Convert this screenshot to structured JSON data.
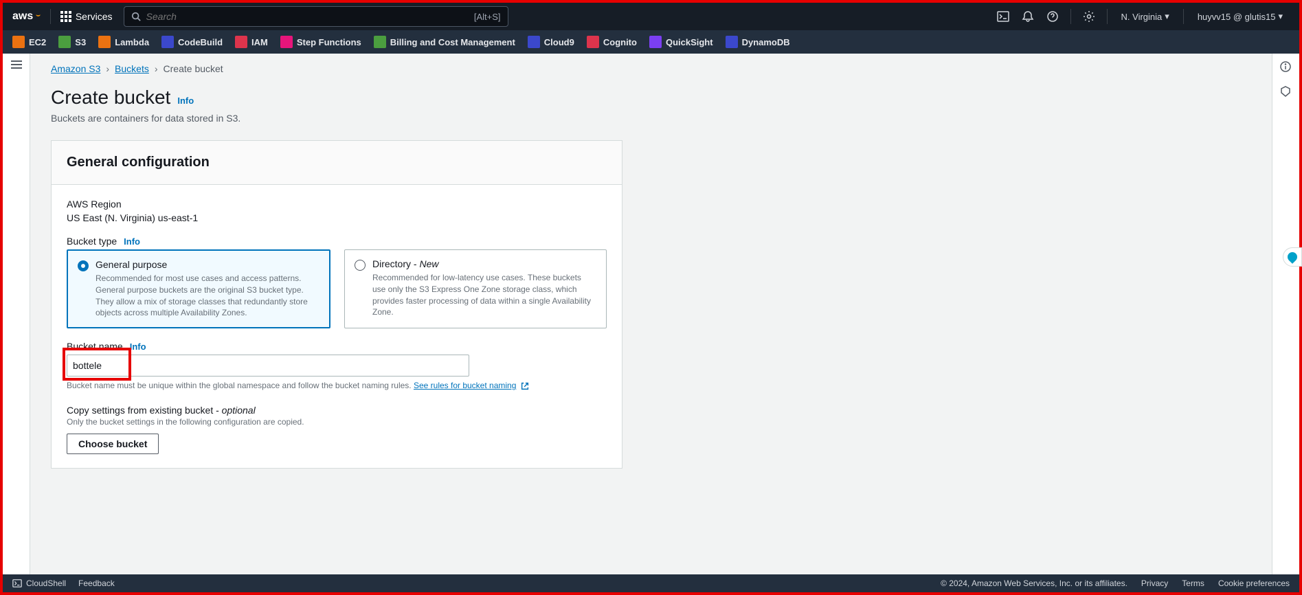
{
  "header": {
    "logo": "aws",
    "services_label": "Services",
    "search_placeholder": "Search",
    "search_shortcut": "[Alt+S]",
    "region": "N. Virginia",
    "account": "huyvv15 @ glutis15"
  },
  "shortcuts": [
    {
      "label": "EC2",
      "color": "#ec7211"
    },
    {
      "label": "S3",
      "color": "#4b9e3f"
    },
    {
      "label": "Lambda",
      "color": "#ec7211"
    },
    {
      "label": "CodeBuild",
      "color": "#3b48cc"
    },
    {
      "label": "IAM",
      "color": "#dd344c"
    },
    {
      "label": "Step Functions",
      "color": "#e7157b"
    },
    {
      "label": "Billing and Cost Management",
      "color": "#4b9e3f"
    },
    {
      "label": "Cloud9",
      "color": "#3b48cc"
    },
    {
      "label": "Cognito",
      "color": "#dd344c"
    },
    {
      "label": "QuickSight",
      "color": "#7b3ff2"
    },
    {
      "label": "DynamoDB",
      "color": "#3b48cc"
    }
  ],
  "breadcrumbs": {
    "items": [
      "Amazon S3",
      "Buckets"
    ],
    "current": "Create bucket"
  },
  "page": {
    "title": "Create bucket",
    "info": "Info",
    "description": "Buckets are containers for data stored in S3."
  },
  "panel": {
    "title": "General configuration",
    "region_label": "AWS Region",
    "region_value": "US East (N. Virginia) us-east-1",
    "bucket_type_label": "Bucket type",
    "info": "Info",
    "options": [
      {
        "title": "General purpose",
        "desc": "Recommended for most use cases and access patterns. General purpose buckets are the original S3 bucket type. They allow a mix of storage classes that redundantly store objects across multiple Availability Zones."
      },
      {
        "title_prefix": "Directory - ",
        "title_suffix": "New",
        "desc": "Recommended for low-latency use cases. These buckets use only the S3 Express One Zone storage class, which provides faster processing of data within a single Availability Zone."
      }
    ],
    "bucket_name_label": "Bucket name",
    "bucket_name_value": "bottele",
    "bucket_name_help_pre": "Bucket name must be unique within the global namespace and follow the bucket naming rules. ",
    "bucket_name_help_link": "See rules for bucket naming",
    "copy_label_pre": "Copy settings from existing bucket - ",
    "copy_label_optional": "optional",
    "copy_help": "Only the bucket settings in the following configuration are copied.",
    "choose_bucket": "Choose bucket"
  },
  "footer": {
    "cloudshell": "CloudShell",
    "feedback": "Feedback",
    "copyright": "© 2024, Amazon Web Services, Inc. or its affiliates.",
    "links": [
      "Privacy",
      "Terms",
      "Cookie preferences"
    ]
  }
}
